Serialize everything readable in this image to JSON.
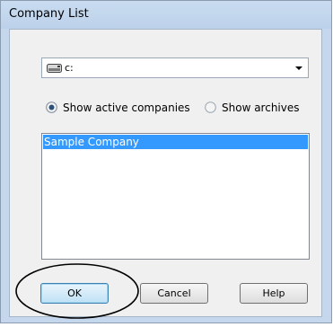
{
  "window": {
    "title": "Company List"
  },
  "drive_combo": {
    "icon": "drive-icon",
    "value": "c:"
  },
  "radio": {
    "active_label": "Show active companies",
    "archives_label": "Show archives",
    "selected": "active"
  },
  "company_list": {
    "items": [
      "Sample Company"
    ],
    "selected_index": 0
  },
  "buttons": {
    "ok": "OK",
    "cancel": "Cancel",
    "help": "Help"
  },
  "colors": {
    "selection": "#3399ff",
    "annotation_circle": "#000000"
  }
}
